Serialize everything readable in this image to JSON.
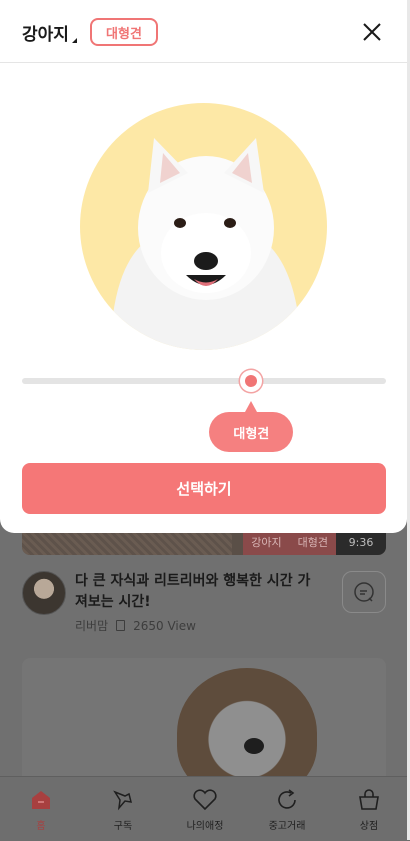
{
  "modal": {
    "species": "강아지",
    "size_badge": "대형견",
    "slider": {
      "value_fraction": 0.63,
      "tooltip": "대형견"
    },
    "select_button": "선택하기",
    "colors": {
      "accent": "#f57777",
      "circle_bg": "#fde8a6"
    }
  },
  "background": {
    "video": {
      "tags": [
        "강아지",
        "대형견"
      ],
      "duration": "9:36"
    },
    "post": {
      "title": "다 큰 자식과 리트리버와 행복한 시간 가져보는 시간!",
      "author": "리버맘",
      "views": "2650 View"
    }
  },
  "tabbar": {
    "items": [
      {
        "label": "홈",
        "icon": "home-icon",
        "active": true
      },
      {
        "label": "구독",
        "icon": "pin-icon",
        "active": false
      },
      {
        "label": "나의애정",
        "icon": "heart-icon",
        "active": false
      },
      {
        "label": "중고거래",
        "icon": "refresh-icon",
        "active": false
      },
      {
        "label": "상점",
        "icon": "shopping-bag-icon",
        "active": false
      }
    ]
  }
}
